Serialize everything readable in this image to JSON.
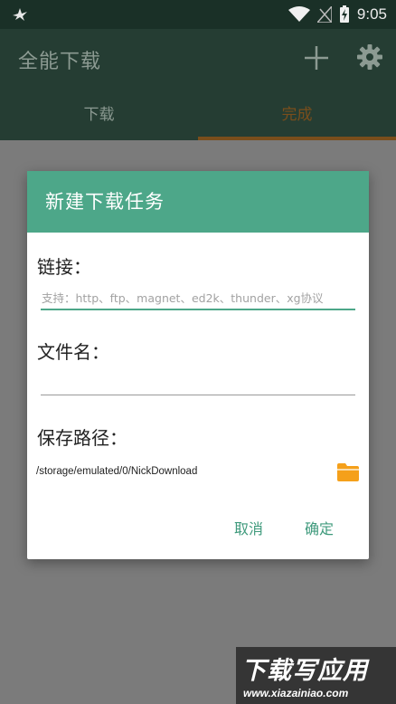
{
  "status_bar": {
    "time": "9:05"
  },
  "app_bar": {
    "title": "全能下载",
    "tabs": [
      {
        "label": "下载",
        "selected": false
      },
      {
        "label": "完成",
        "selected": true
      }
    ]
  },
  "dialog": {
    "title": "新建下载任务",
    "link_label": "链接：",
    "link_placeholder": "支持：http、ftp、magnet、ed2k、thunder、xg协议",
    "link_value": "",
    "filename_label": "文件名：",
    "filename_value": "",
    "save_path_label": "保存路径：",
    "save_path": "/storage/emulated/0/NickDownload",
    "cancel_label": "取消",
    "ok_label": "确定"
  },
  "watermark": {
    "text": "下载写应用",
    "url": "www.xiazainiao.com"
  },
  "colors": {
    "accent": "#4da789",
    "orange": "#f5a01a",
    "appbar": "#253d33"
  }
}
